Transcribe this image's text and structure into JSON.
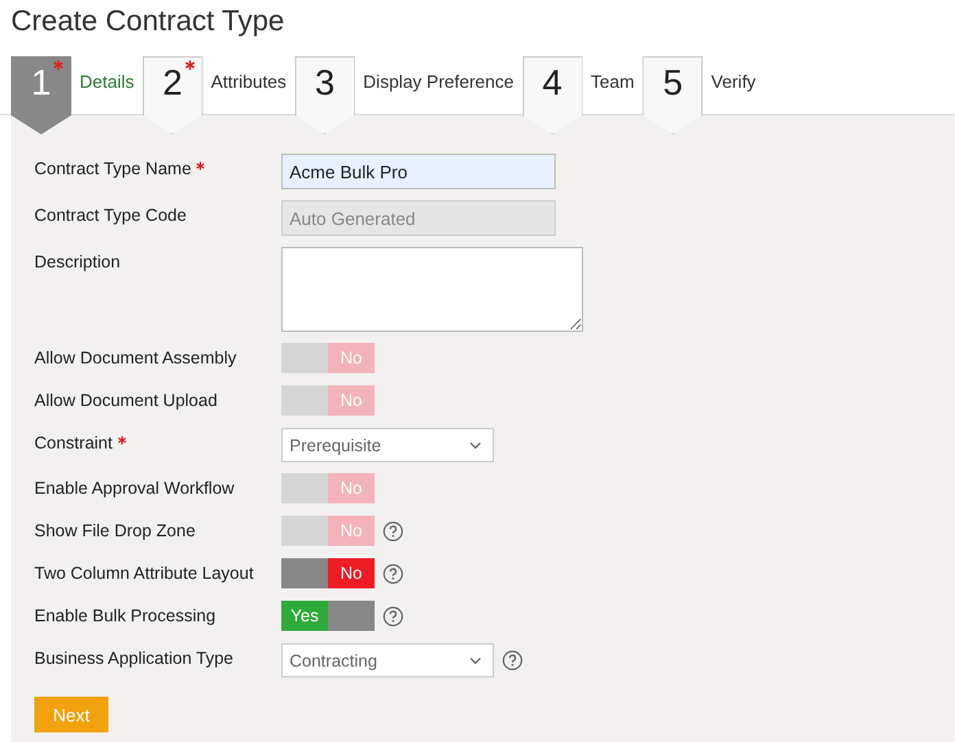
{
  "title": "Create Contract Type",
  "steps": [
    {
      "number": "1",
      "label": "Details",
      "selected": true,
      "required": true
    },
    {
      "number": "2",
      "label": "Attributes",
      "selected": false,
      "required": true
    },
    {
      "number": "3",
      "label": "Display Preference",
      "selected": false,
      "required": false
    },
    {
      "number": "4",
      "label": "Team",
      "selected": false,
      "required": false
    },
    {
      "number": "5",
      "label": "Verify",
      "selected": false,
      "required": false
    }
  ],
  "fields": [
    {
      "kind": "text",
      "label": "Contract Type Name",
      "required": true,
      "value": "Acme Bulk Pro",
      "disabled": false,
      "help": false
    },
    {
      "kind": "text",
      "label": "Contract Type Code",
      "required": false,
      "placeholder": "Auto Generated",
      "disabled": true,
      "help": false
    },
    {
      "kind": "textarea",
      "label": "Description",
      "required": false,
      "disabled": false,
      "help": false
    },
    {
      "kind": "toggle",
      "label": "Allow Document Assembly",
      "required": false,
      "on": false,
      "text": "No",
      "disabled": true,
      "help": false
    },
    {
      "kind": "toggle",
      "label": "Allow Document Upload",
      "required": false,
      "on": false,
      "text": "No",
      "disabled": true,
      "help": false
    },
    {
      "kind": "select",
      "label": "Constraint",
      "required": true,
      "value": "Prerequisite",
      "disabled": false,
      "help": false
    },
    {
      "kind": "toggle",
      "label": "Enable Approval Workflow",
      "required": false,
      "on": false,
      "text": "No",
      "disabled": true,
      "help": false
    },
    {
      "kind": "toggle",
      "label": "Show File Drop Zone",
      "required": false,
      "on": false,
      "text": "No",
      "disabled": true,
      "help": true
    },
    {
      "kind": "toggle",
      "label": "Two Column Attribute Layout",
      "required": false,
      "on": false,
      "text": "No",
      "disabled": false,
      "help": true
    },
    {
      "kind": "toggle",
      "label": "Enable Bulk Processing",
      "required": false,
      "on": true,
      "text": "Yes",
      "disabled": false,
      "help": true
    },
    {
      "kind": "select",
      "label": "Business Application Type",
      "required": false,
      "value": "Contracting",
      "disabled": false,
      "help": true
    }
  ],
  "next_button": "Next"
}
